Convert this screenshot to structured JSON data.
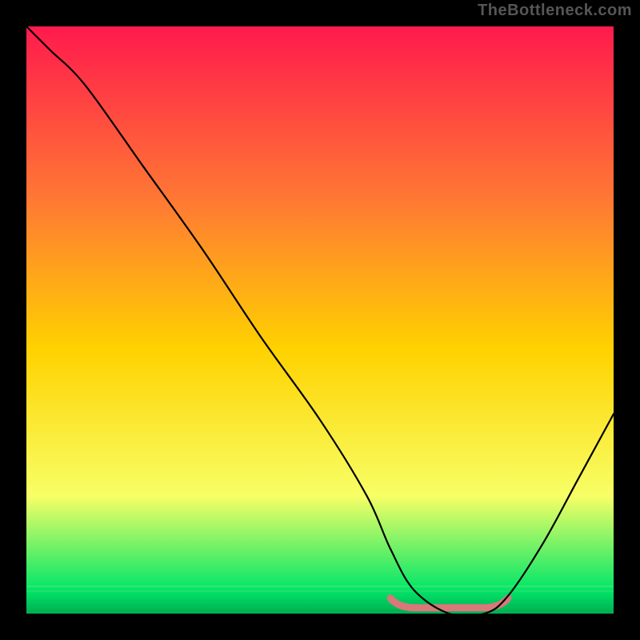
{
  "watermark": "TheBottleneck.com",
  "chart_data": {
    "type": "line",
    "title": "",
    "xlabel": "",
    "ylabel": "",
    "xlim": [
      0,
      100
    ],
    "ylim": [
      0,
      100
    ],
    "grid": false,
    "legend": false,
    "background_gradient": {
      "top": "#ff1a4d",
      "upper_mid": "#ff7a33",
      "mid": "#ffd200",
      "lower_mid": "#f7ff66",
      "bottom": "#00e668",
      "bottom_edge": "#00b050"
    },
    "series": [
      {
        "name": "bottleneck-curve",
        "color": "#000000",
        "x": [
          0,
          4,
          10,
          20,
          30,
          40,
          50,
          58,
          62,
          66,
          72,
          78,
          82,
          88,
          94,
          100
        ],
        "y": [
          100,
          96,
          90,
          76,
          62,
          47,
          33,
          20,
          11,
          4,
          0,
          0,
          3,
          12,
          23,
          34
        ]
      }
    ],
    "highlight_band": {
      "name": "optimal-range",
      "color": "#d9777a",
      "x_start": 62,
      "x_end": 82,
      "y_approx": 1.0
    }
  }
}
